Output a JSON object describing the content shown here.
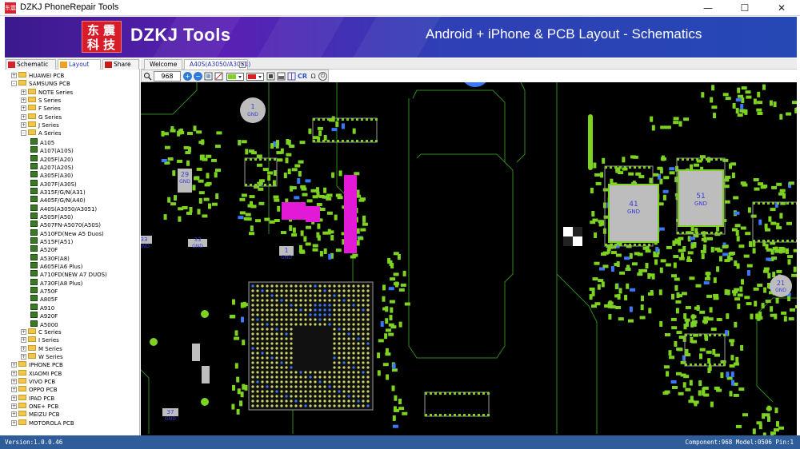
{
  "window": {
    "title": "DZKJ PhoneRepair Tools",
    "app_icon_text": "东震",
    "min_glyph": "—",
    "max_glyph": "☐",
    "close_glyph": "✕"
  },
  "banner": {
    "logo_chars": [
      "东",
      "震",
      "科",
      "技"
    ],
    "brand": "DZKJ Tools",
    "slogan": "Android + iPhone & PCB Layout - Schematics",
    "colors": {
      "start": "#3a1a8c",
      "mid": "#5a1fb4",
      "end": "#2548b5",
      "logo": "#d91c2a"
    }
  },
  "left_tabs": {
    "schematic": "Schematic",
    "layout": "Layout",
    "share": "Share"
  },
  "tree": [
    {
      "label": "HUAWEI PCB",
      "level": 0,
      "kind": "folder",
      "exp": "+"
    },
    {
      "label": "SAMSUNG PCB",
      "level": 0,
      "kind": "folder",
      "exp": "-"
    },
    {
      "label": "NOTE Series",
      "level": 1,
      "kind": "folder",
      "exp": "+"
    },
    {
      "label": "S Series",
      "level": 1,
      "kind": "folder",
      "exp": "+"
    },
    {
      "label": "F Series",
      "level": 1,
      "kind": "folder",
      "exp": "+"
    },
    {
      "label": "G Series",
      "level": 1,
      "kind": "folder",
      "exp": "+"
    },
    {
      "label": "J Series",
      "level": 1,
      "kind": "folder",
      "exp": "+"
    },
    {
      "label": "A Series",
      "level": 1,
      "kind": "folder",
      "exp": "-"
    },
    {
      "label": "A105",
      "level": 2,
      "kind": "board"
    },
    {
      "label": "A107(A10S)",
      "level": 2,
      "kind": "board"
    },
    {
      "label": "A205F(A20)",
      "level": 2,
      "kind": "board"
    },
    {
      "label": "A207(A20S)",
      "level": 2,
      "kind": "board"
    },
    {
      "label": "A305F(A30)",
      "level": 2,
      "kind": "board"
    },
    {
      "label": "A307F(A30S)",
      "level": 2,
      "kind": "board"
    },
    {
      "label": "A315F/G/N(A31)",
      "level": 2,
      "kind": "board"
    },
    {
      "label": "A405F/G/N(A40)",
      "level": 2,
      "kind": "board"
    },
    {
      "label": "A40S(A3050/A3051)",
      "level": 2,
      "kind": "board"
    },
    {
      "label": "A505F(A50)",
      "level": 2,
      "kind": "board"
    },
    {
      "label": "A507FN-A5070(A50S)",
      "level": 2,
      "kind": "board"
    },
    {
      "label": "A510FD(New A5 Duos)",
      "level": 2,
      "kind": "board"
    },
    {
      "label": "A515F(A51)",
      "level": 2,
      "kind": "board"
    },
    {
      "label": "A520F",
      "level": 2,
      "kind": "board"
    },
    {
      "label": "A530F(A8)",
      "level": 2,
      "kind": "board"
    },
    {
      "label": "A605F(A6 Plus)",
      "level": 2,
      "kind": "board"
    },
    {
      "label": "A710FD(NEW A7 DUOS)",
      "level": 2,
      "kind": "board"
    },
    {
      "label": "A730F(A8 Plus)",
      "level": 2,
      "kind": "board"
    },
    {
      "label": "A750F",
      "level": 2,
      "kind": "board"
    },
    {
      "label": "A805F",
      "level": 2,
      "kind": "board"
    },
    {
      "label": "A910",
      "level": 2,
      "kind": "board"
    },
    {
      "label": "A920F",
      "level": 2,
      "kind": "board"
    },
    {
      "label": "A5000",
      "level": 2,
      "kind": "board"
    },
    {
      "label": "C Series",
      "level": 1,
      "kind": "folder",
      "exp": "+"
    },
    {
      "label": "I Series",
      "level": 1,
      "kind": "folder",
      "exp": "+"
    },
    {
      "label": "M Series",
      "level": 1,
      "kind": "folder",
      "exp": "+"
    },
    {
      "label": "W Series",
      "level": 1,
      "kind": "folder",
      "exp": "+"
    },
    {
      "label": "IPHONE PCB",
      "level": 0,
      "kind": "folder",
      "exp": "+"
    },
    {
      "label": "XIAOMI PCB",
      "level": 0,
      "kind": "folder",
      "exp": "+"
    },
    {
      "label": "VIVO PCB",
      "level": 0,
      "kind": "folder",
      "exp": "+"
    },
    {
      "label": "OPPO PCB",
      "level": 0,
      "kind": "folder",
      "exp": "+"
    },
    {
      "label": "IPAD PCB",
      "level": 0,
      "kind": "folder",
      "exp": "+"
    },
    {
      "label": "ONE+ PCB",
      "level": 0,
      "kind": "folder",
      "exp": "+"
    },
    {
      "label": "MEIZU PCB",
      "level": 0,
      "kind": "folder",
      "exp": "+"
    },
    {
      "label": "MOTOROLA PCB",
      "level": 0,
      "kind": "folder",
      "exp": "+"
    }
  ],
  "doc_tabs": {
    "welcome": "Welcome",
    "active": "A40S(A3050/A3051)",
    "close_glyph": "×"
  },
  "toolbar": {
    "zoom_value": "968",
    "cr_label": "CR",
    "omega_label": "Ω",
    "power_glyph": "⏻",
    "zoom_in_glyph": "+",
    "zoom_out_glyph": "−"
  },
  "canvas_labels": {
    "gnd": "GND",
    "pads": [
      "1",
      "29",
      "41",
      "51",
      "21",
      "1",
      "33",
      "33",
      "37"
    ],
    "colors": {
      "bg": "#000000",
      "outline": "#2f8a1c",
      "pad": "#7ed321",
      "net_pin": "#3a78ff",
      "highlight": "#e21ad7",
      "label_grey": "#bdbdbd",
      "label_text": "#3b3bd8"
    }
  },
  "status": {
    "version": "Version:1.0.0.46",
    "info": "Component:968 Model:0506 Pin:1"
  }
}
